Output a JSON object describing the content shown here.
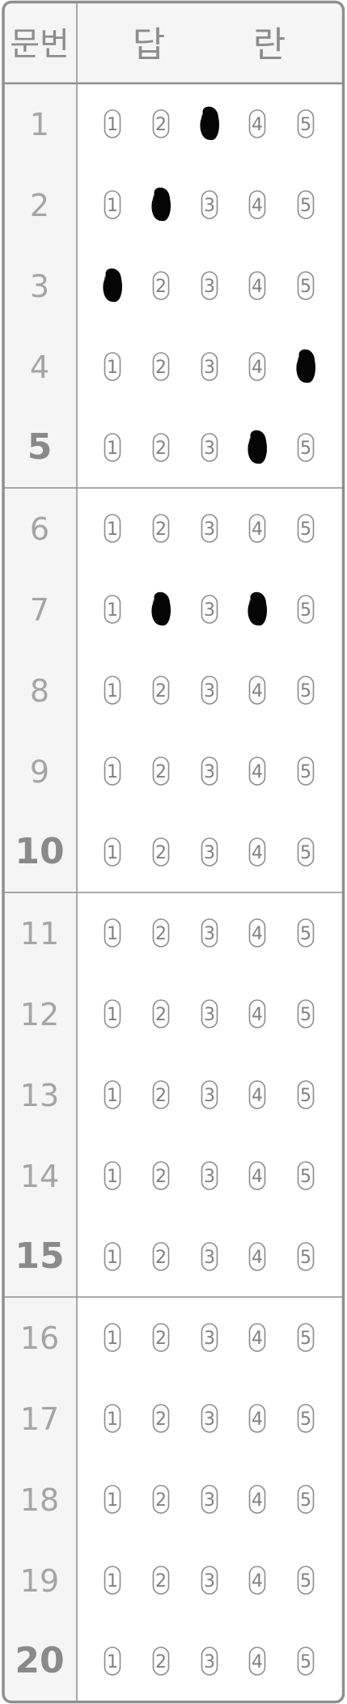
{
  "header": {
    "col_number": "문번",
    "col_answer_1": "답",
    "col_answer_2": "란"
  },
  "choices": [
    "1",
    "2",
    "3",
    "4",
    "5"
  ],
  "questions": [
    {
      "number": "1",
      "marked": [
        3
      ]
    },
    {
      "number": "2",
      "marked": [
        2
      ]
    },
    {
      "number": "3",
      "marked": [
        1
      ]
    },
    {
      "number": "4",
      "marked": [
        5
      ]
    },
    {
      "number": "5",
      "marked": [
        4
      ]
    },
    {
      "number": "6",
      "marked": []
    },
    {
      "number": "7",
      "marked": [
        2,
        4
      ]
    },
    {
      "number": "8",
      "marked": []
    },
    {
      "number": "9",
      "marked": []
    },
    {
      "number": "10",
      "marked": []
    },
    {
      "number": "11",
      "marked": []
    },
    {
      "number": "12",
      "marked": []
    },
    {
      "number": "13",
      "marked": []
    },
    {
      "number": "14",
      "marked": []
    },
    {
      "number": "15",
      "marked": []
    },
    {
      "number": "16",
      "marked": []
    },
    {
      "number": "17",
      "marked": []
    },
    {
      "number": "18",
      "marked": []
    },
    {
      "number": "19",
      "marked": []
    },
    {
      "number": "20",
      "marked": []
    }
  ],
  "colors": {
    "frame": "#8f8f8f",
    "header_bg": "#f5f5f5",
    "number_text": "#a5a5a5",
    "bold_number_text": "#8a8a8a",
    "bubble_stroke": "#8c8c8c",
    "bubble_text": "#808080",
    "mark_fill": "#050505"
  }
}
